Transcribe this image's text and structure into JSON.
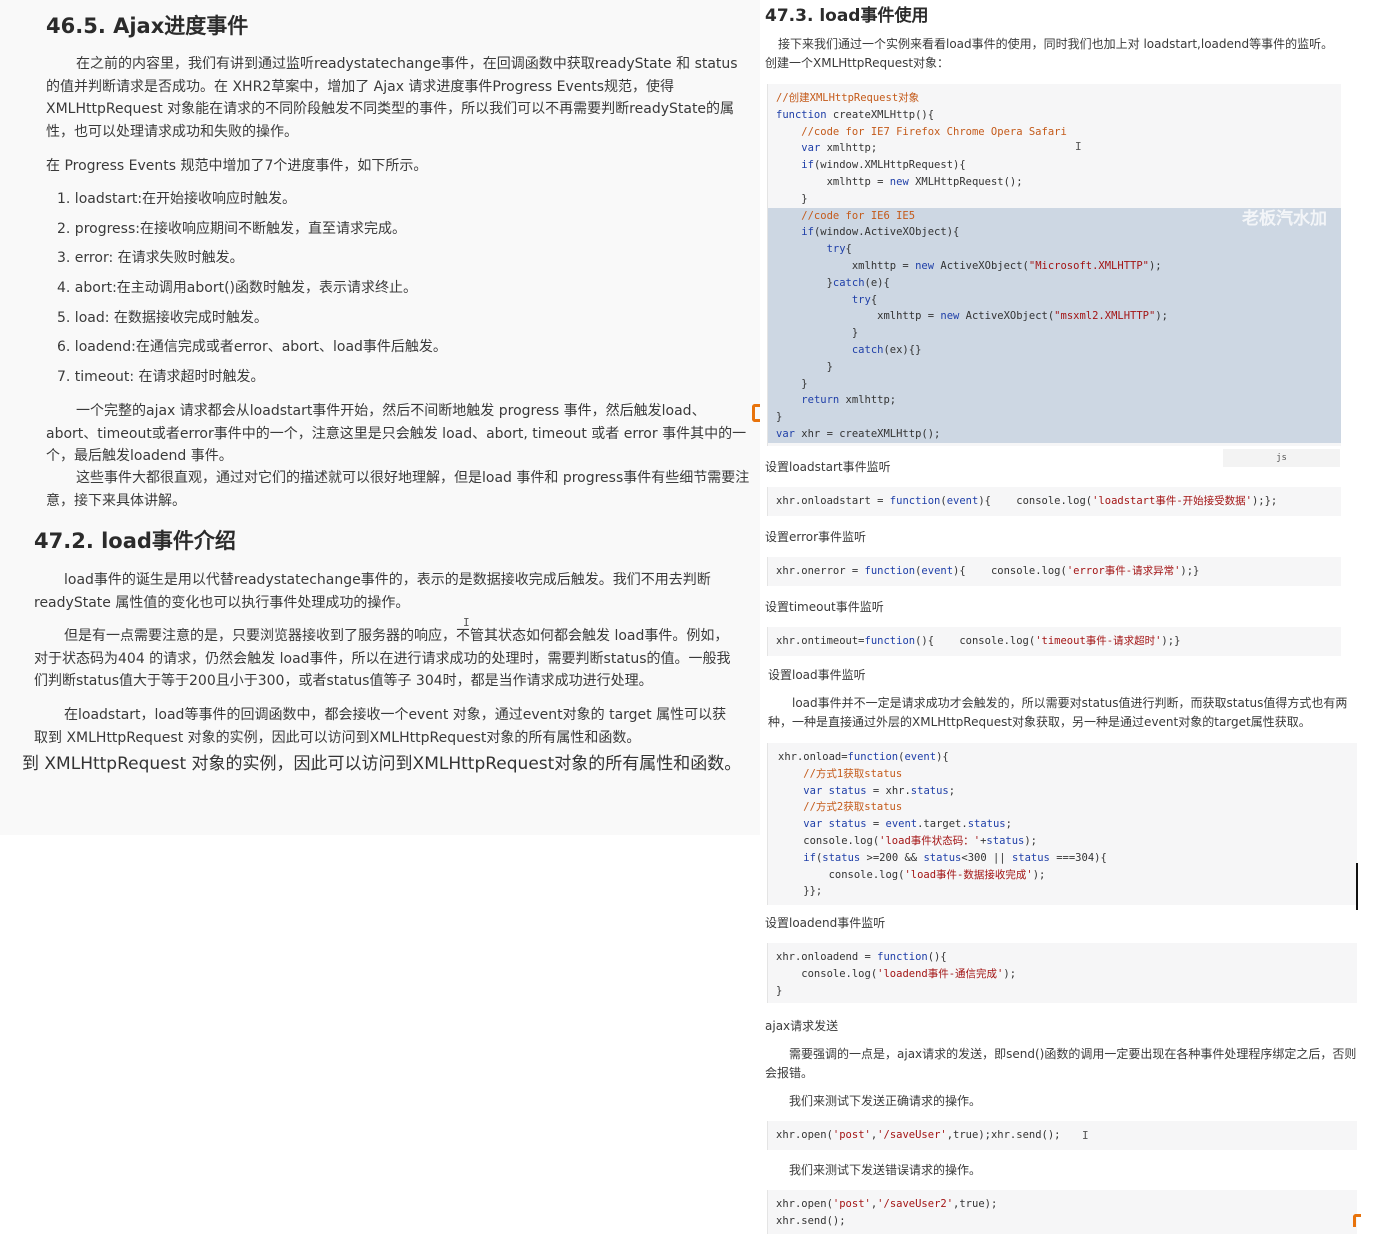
{
  "left": {
    "s1_title": "46.5. Ajax进度事件",
    "s1_p1": "在之前的内容里，我们有讲到通过监听readystatechange事件，在回调函数中获取readyState 和 status 的值并判断请求是否成功。在 XHR2草案中，增加了 Ajax 请求进度事件Progress Events规范，使得 XMLHttpRequest 对象能在请求的不同阶段触发不同类型的事件，所以我们可以不再需要判断readyState的属性，也可以处理请求成功和失败的操作。",
    "s1_p2": "在 Progress Events 规范中增加了7个进度事件，如下所示。",
    "events": [
      "1. loadstart:在开始接收响应时触发。",
      "2. progress:在接收响应期间不断触发，直至请求完成。",
      "3. error: 在请求失败时触发。",
      "4. abort:在主动调用abort()函数时触发，表示请求终止。",
      "5. load: 在数据接收完成时触发。",
      "6. loadend:在通信完成或者error、abort、load事件后触发。",
      "7. timeout: 在请求超时时触发。"
    ],
    "s1_p3": "一个完整的ajax 请求都会从loadstart事件开始，然后不间断地触发 progress 事件，然后触发load、abort、timeout或者error事件中的一个，注意这里是只会触发 load、abort, timeout 或者 error 事件其中的一个，最后触发loadend 事件。",
    "s1_p4": "这些事件大都很直观，通过对它们的描述就可以很好地理解，但是load 事件和 progress事件有些细节需要注意，接下来具体讲解。",
    "s2_title": "47.2. load事件介绍",
    "s2_p1": "load事件的诞生是用以代替readystatechange事件的，表示的是数据接收完成后触发。我们不用去判断 readyState 属性值的变化也可以执行事件处理成功的操作。",
    "s2_p2": "但是有一点需要注意的是，只要浏览器接收到了服务器的响应，不管其状态如何都会触发 load事件。例如，对于状态码为404 的请求，仍然会触发 load事件，所以在进行请求成功的处理时，需要判断status的值。一般我们判断status值大于等于200且小于300，或者status值等子 304时，都是当作请求成功进行处理。",
    "s2_p3": "在loadstart，load等事件的回调函数中，都会接收一个event 对象，通过event对象的 target 属性可以获取到 XMLHttpRequest 对象的实例，因此可以访问到XMLHttpRequest对象的所有属性和函数。",
    "ghost_text": "到 XMLHttpRequest 对象的实例，因此可以访问到XMLHttpRequest对象的所有属性和函数。"
  },
  "right": {
    "title": "47.3. load事件使用",
    "intro": "接下来我们通过一个实例来看看load事件的使用，同时我们也加上对 loadstart,loadend等事件的监听。",
    "intro2": "创建一个XMLHttpRequest对象：",
    "watermark": "老板汽水加",
    "lang_tag": "js",
    "label_loadstart": "设置loadstart事件监听",
    "label_error": "设置error事件监听",
    "label_timeout": "设置timeout事件监听",
    "label_load": "设置load事件监听",
    "load_desc": "load事件并不一定是请求成功才会触发的，所以需要对status值进行判断，而获取status值得方式也有两种，一种是直接通过外层的XMLHttpRequest对象获取，另一种是通过event对象的target属性获取。",
    "label_loadend": "设置loadend事件监听",
    "label_send": "ajax请求发送",
    "send_desc": "需要强调的一点是，ajax请求的发送，即send()函数的调用一定要出现在各种事件处理程序绑定之后，否则会报错。",
    "test_ok": "我们来测试下发送正确请求的操作。",
    "test_err": "我们来测试下发送错误请求的操作。"
  },
  "code": {
    "create": [
      "//创建XMLHttpRequest对象",
      "function createXMLHttp(){",
      "    //code for IE7 Firefox Chrome Opera Safari",
      "    var xmlhttp;",
      "    if(window.XMLHttpRequest){",
      "        xmlhttp = new XMLHttpRequest();",
      "    }",
      "    //code for IE6 IE5",
      "    if(window.ActiveXObject){",
      "        try{",
      "            xmlhttp = new ActiveXObject(\"Microsoft.XMLHTTP\");",
      "        }catch(e){",
      "            try{",
      "                xmlhttp = new ActiveXObject(\"msxml2.XMLHTTP\");",
      "            }",
      "            catch(ex){}",
      "        }",
      "    }",
      "    return xmlhttp;",
      "}",
      "var xhr = createXMLHttp();"
    ],
    "loadstart": "xhr.onloadstart = function(event){    console.log('loadstart事件-开始接受数据');};",
    "error": "xhr.onerror = function(event){    console.log('error事件-请求异常');}",
    "timeout": "xhr.ontimeout=function(){    console.log('timeout事件-请求超时');}",
    "load": [
      "xhr.onload=function(event){",
      "    //方式1获取status",
      "    var status = xhr.status;",
      "    //方式2获取status",
      "    var status = event.target.status;",
      "    console.log('load事件状态码：'+status);",
      "    if(status >=200 && status<300 || status ===304){",
      "        console.log('load事件-数据接收完成');",
      "    }};"
    ],
    "loadend": [
      "xhr.onloadend = function(){",
      "    console.log('loadend事件-通信完成');",
      "}"
    ],
    "send_ok": "xhr.open('post','/saveUser',true);xhr.send();",
    "send_err": [
      "xhr.open('post','/saveUser2',true);",
      "xhr.send();"
    ]
  }
}
